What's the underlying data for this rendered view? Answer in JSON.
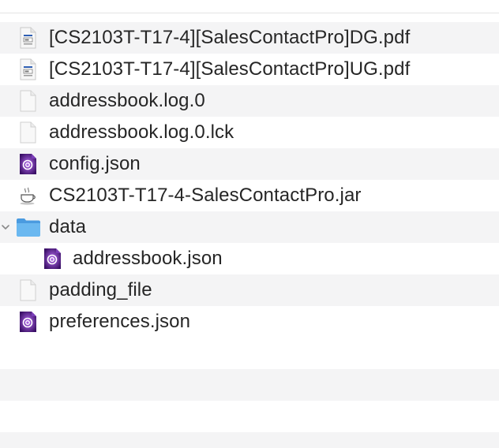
{
  "files": [
    {
      "label": "[CS2103T-T17-4][SalesContactPro]DG.pdf",
      "icon": "pdf-document-icon",
      "level": 0
    },
    {
      "label": "[CS2103T-T17-4][SalesContactPro]UG.pdf",
      "icon": "pdf-document-icon",
      "level": 0
    },
    {
      "label": "addressbook.log.0",
      "icon": "blank-document-icon",
      "level": 0
    },
    {
      "label": "addressbook.log.0.lck",
      "icon": "blank-document-icon",
      "level": 0
    },
    {
      "label": "config.json",
      "icon": "json-document-icon",
      "level": 0
    },
    {
      "label": "CS2103T-T17-4-SalesContactPro.jar",
      "icon": "java-coffee-cup-icon",
      "level": 0
    },
    {
      "label": "data",
      "icon": "folder-icon",
      "level": 0,
      "expanded": true
    },
    {
      "label": "addressbook.json",
      "icon": "json-document-icon",
      "level": 1
    },
    {
      "label": "padding_file",
      "icon": "blank-document-icon",
      "level": 0
    },
    {
      "label": "preferences.json",
      "icon": "json-document-icon",
      "level": 0
    }
  ],
  "colors": {
    "alt_row": "#f4f4f5",
    "text": "#262626",
    "folder": "#5aacec",
    "json_purple": "#5b1f8f"
  }
}
